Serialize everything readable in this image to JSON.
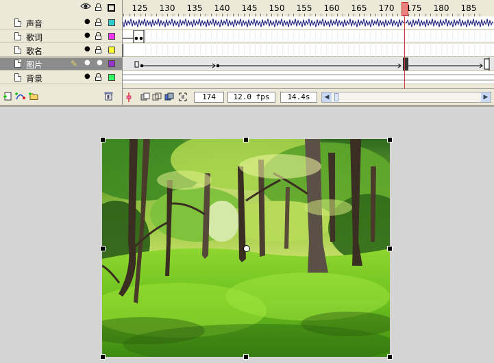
{
  "header_icons": {
    "eye": "eye-icon",
    "lock": "lock-icon",
    "outline": "outline-icon"
  },
  "layers": [
    {
      "name": "声音",
      "color": "#33cccc",
      "selected": false
    },
    {
      "name": "歌词",
      "color": "#ff33ff",
      "selected": false
    },
    {
      "name": "歌名",
      "color": "#ffff33",
      "selected": false
    },
    {
      "name": "图片",
      "color": "#9933cc",
      "selected": true
    },
    {
      "name": "背景",
      "color": "#33ff66",
      "selected": false
    }
  ],
  "ruler": {
    "labels": [
      "125",
      "130",
      "135",
      "140",
      "145",
      "150",
      "155",
      "160",
      "165",
      "170",
      "175",
      "180",
      "185"
    ]
  },
  "status": {
    "current_frame": "174",
    "frame_rate": "12.0 fps",
    "elapsed": "14.4s"
  },
  "tools": {
    "insert_layer": "insert-layer-icon",
    "add_guide": "add-motion-guide-icon",
    "insert_folder": "insert-folder-icon",
    "delete": "trash-icon",
    "center_frame": "center-frame-icon",
    "onion_skin": "onion-skin-icon",
    "onion_outline": "onion-outline-icon",
    "edit_multiple": "edit-multiple-frames-icon",
    "modify_markers": "modify-onion-markers-icon"
  },
  "colors": {
    "playhead": "#d0383a",
    "waveform": "#1a1a7a",
    "panel": "#ece9d8"
  }
}
